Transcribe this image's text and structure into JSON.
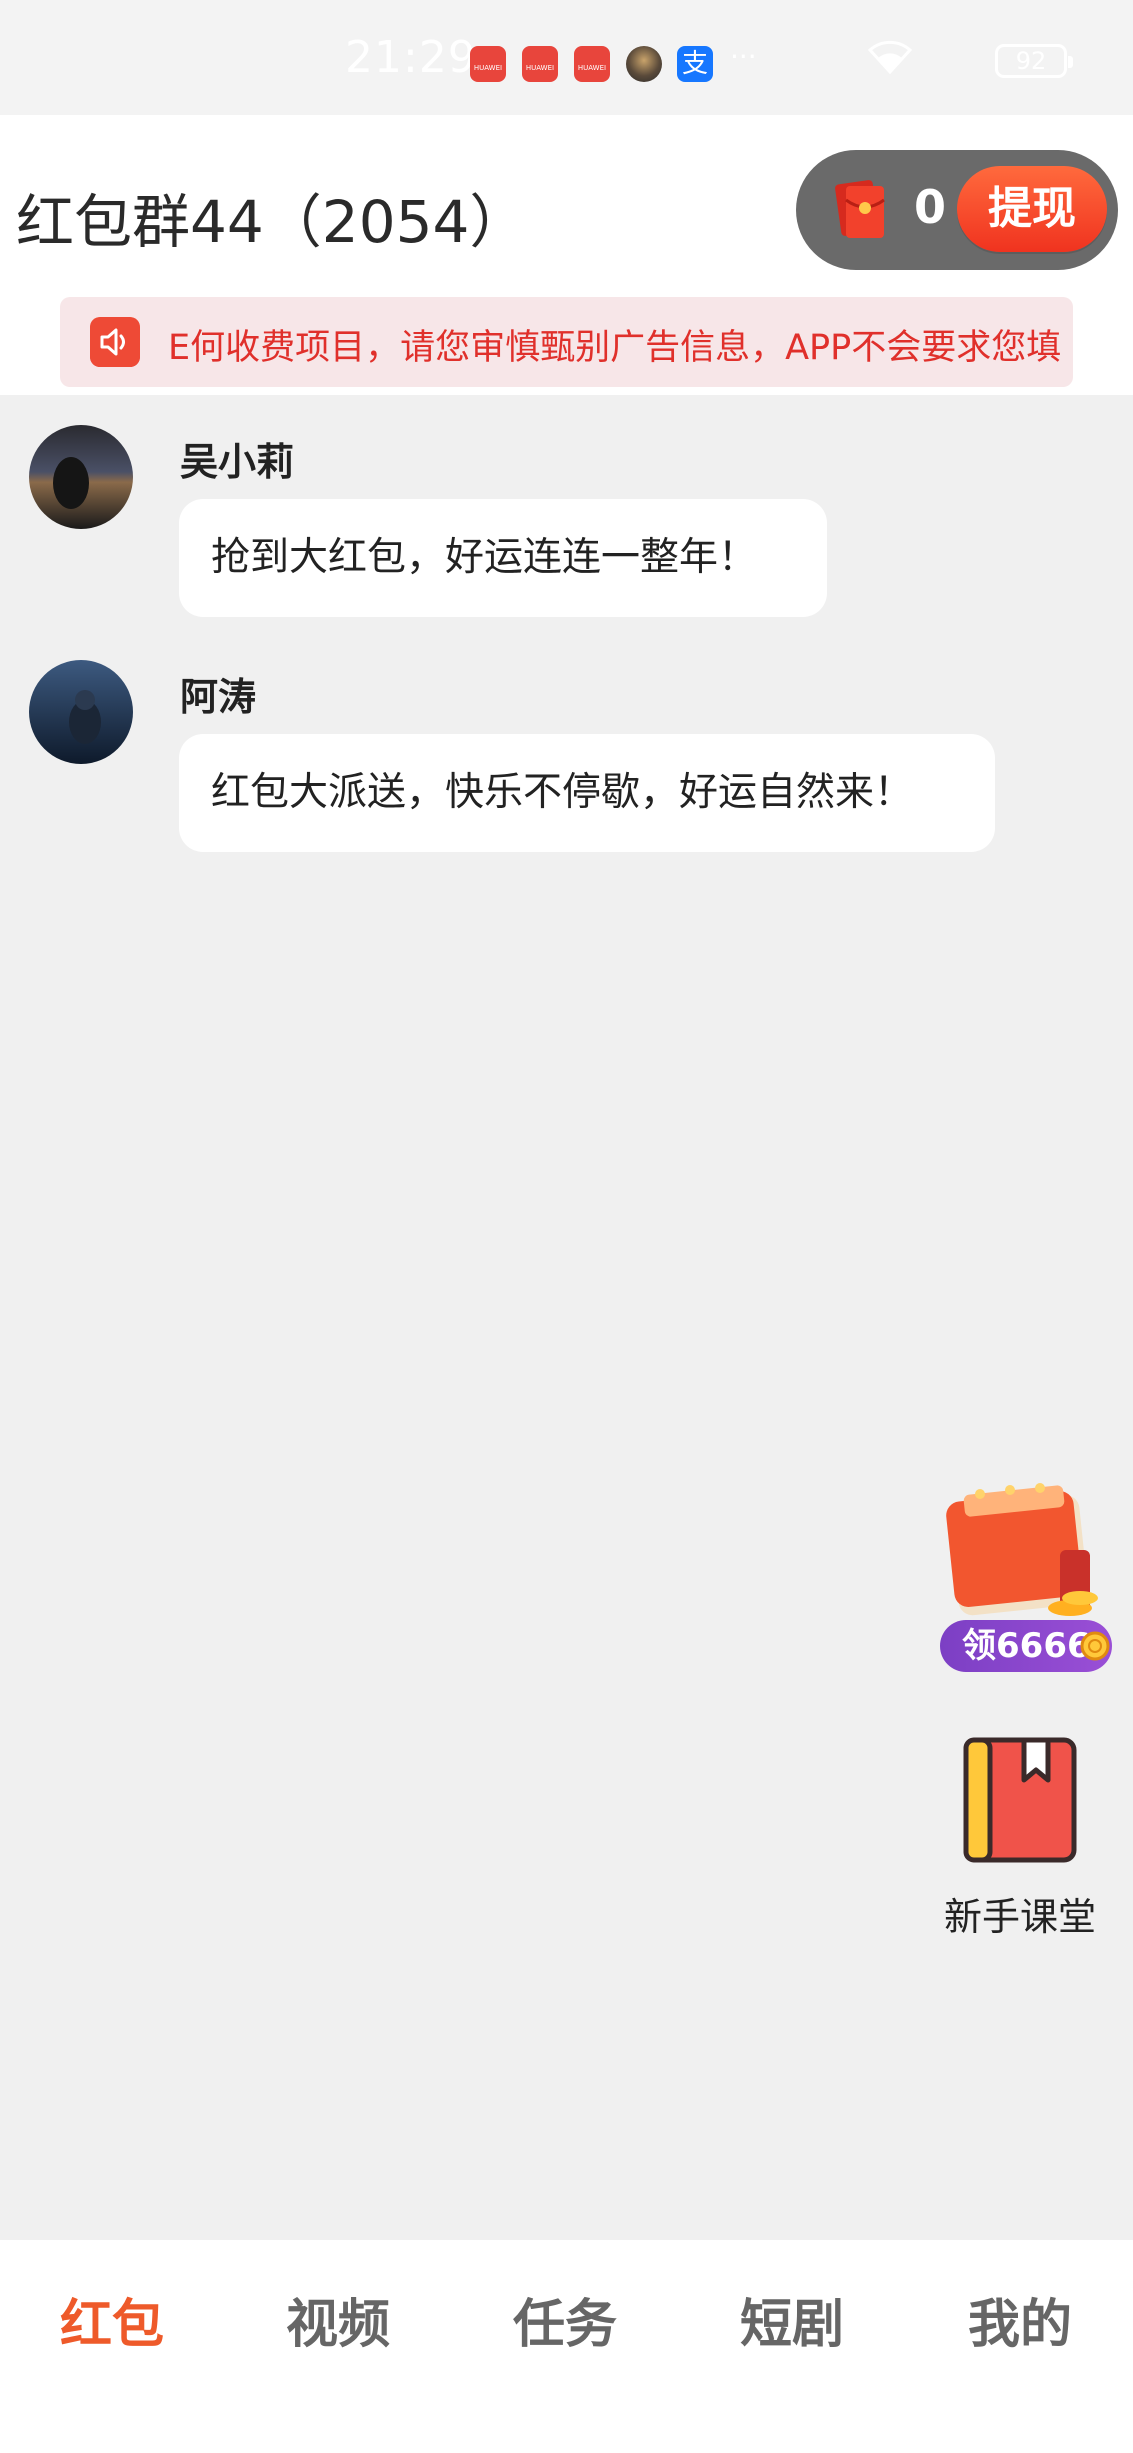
{
  "status_bar": {
    "time": "21:29",
    "app_icon_label": "HUAWEI",
    "alipay_glyph": "支",
    "more": "···",
    "battery": "92"
  },
  "header": {
    "title": "红包群44（2054）",
    "wallet_balance": "0",
    "withdraw_label": "提现"
  },
  "notice": {
    "text": "E何收费项目，请您审慎甄别广告信息，APP不会要求您填"
  },
  "messages": [
    {
      "sender": "吴小莉",
      "text": "抢到大红包，好运连连一整年！"
    },
    {
      "sender": "阿涛",
      "text": "红包大派送，快乐不停歇，好运自然来！"
    }
  ],
  "floating": {
    "reward_badge": "领6666",
    "beginner_label": "新手课堂"
  },
  "bottom_nav": {
    "items": [
      {
        "label": "红包",
        "active": true
      },
      {
        "label": "视频",
        "active": false
      },
      {
        "label": "任务",
        "active": false
      },
      {
        "label": "短剧",
        "active": false
      },
      {
        "label": "我的",
        "active": false
      }
    ]
  },
  "colors": {
    "accent": "#ee5a2a",
    "notice_text": "#e0302b",
    "background": "#f0f0f0"
  }
}
